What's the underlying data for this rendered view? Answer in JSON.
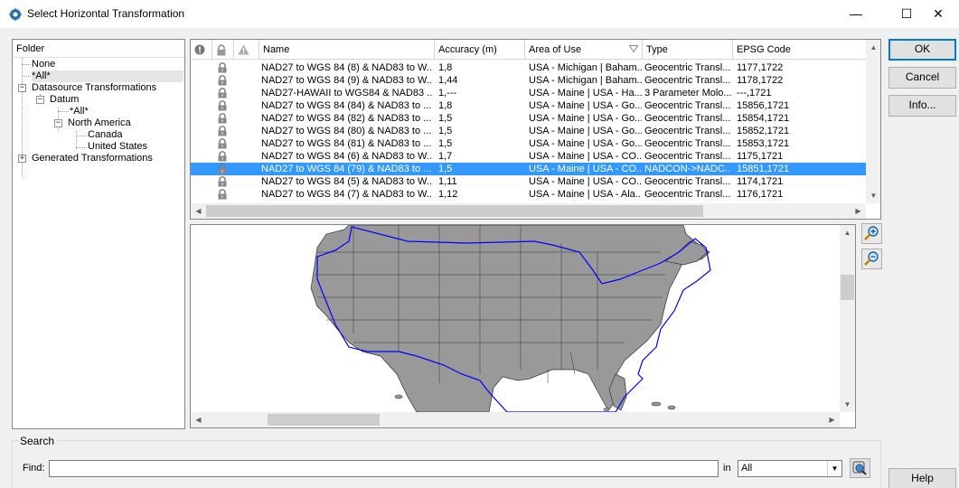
{
  "window": {
    "title": "Select Horizontal Transformation",
    "minimize_glyph": "—",
    "maximize_glyph": "☐",
    "close_glyph": "✕"
  },
  "folder": {
    "header": "Folder",
    "tree": [
      {
        "label": "None",
        "expander": ""
      },
      {
        "label": "*All*",
        "expander": "",
        "selected": true
      },
      {
        "label": "Datasource Transformations",
        "expander": "−"
      },
      {
        "label": "Datum",
        "expander": "−"
      },
      {
        "label": "*All*",
        "expander": ""
      },
      {
        "label": "North America",
        "expander": "−"
      },
      {
        "label": "Canada",
        "expander": ""
      },
      {
        "label": "United States",
        "expander": ""
      },
      {
        "label": "Generated Transformations",
        "expander": "+"
      }
    ]
  },
  "grid": {
    "columns": [
      "",
      "",
      "",
      "Name",
      "Accuracy (m)",
      "Area of Use",
      "Type",
      "EPSG Code"
    ],
    "header_icons": [
      "warning-circle-icon",
      "lock-icon",
      "alert-triangle-icon"
    ],
    "rows": [
      {
        "name": "NAD27 to WGS 84 (8) & NAD83 to W...",
        "accuracy": "1,8",
        "area": "USA - Michigan | Baham...",
        "type": "Geocentric Transl...",
        "epsg": "1177,1722"
      },
      {
        "name": "NAD27 to WGS 84 (9) & NAD83 to W...",
        "accuracy": "1,44",
        "area": "USA - Michigan | Baham...",
        "type": "Geocentric Transl...",
        "epsg": "1178,1722"
      },
      {
        "name": "NAD27-HAWAII to WGS84 & NAD83 ...",
        "accuracy": "1,---",
        "area": "USA - Maine | USA - Ha...",
        "type": "3 Parameter Molo...",
        "epsg": "---,1721"
      },
      {
        "name": "NAD27 to WGS 84 (84) & NAD83 to ...",
        "accuracy": "1,8",
        "area": "USA - Maine | USA - Go...",
        "type": "Geocentric Transl...",
        "epsg": "15856,1721"
      },
      {
        "name": "NAD27 to WGS 84 (82) & NAD83 to ...",
        "accuracy": "1,5",
        "area": "USA - Maine | USA - Go...",
        "type": "Geocentric Transl...",
        "epsg": "15854,1721"
      },
      {
        "name": "NAD27 to WGS 84 (80) & NAD83 to ...",
        "accuracy": "1,5",
        "area": "USA - Maine | USA - Go...",
        "type": "Geocentric Transl...",
        "epsg": "15852,1721"
      },
      {
        "name": "NAD27 to WGS 84 (81) & NAD83 to ...",
        "accuracy": "1,5",
        "area": "USA - Maine | USA - Go...",
        "type": "Geocentric Transl...",
        "epsg": "15853,1721"
      },
      {
        "name": "NAD27 to WGS 84 (6) & NAD83 to W...",
        "accuracy": "1,7",
        "area": "USA - Maine | USA - CO...",
        "type": "Geocentric Transl...",
        "epsg": "1175,1721"
      },
      {
        "name": "NAD27 to WGS 84 (79) & NAD83 to ...",
        "accuracy": "1,5",
        "area": "USA - Maine | USA - CO...",
        "type": "NADCON->NADC...",
        "epsg": "15851,1721",
        "selected": true
      },
      {
        "name": "NAD27 to WGS 84 (5) & NAD83 to W...",
        "accuracy": "1,11",
        "area": "USA - Maine | USA - CO...",
        "type": "Geocentric Transl...",
        "epsg": "1174,1721"
      },
      {
        "name": "NAD27 to WGS 84 (7) & NAD83 to W...",
        "accuracy": "1,12",
        "area": "USA - Maine | USA - Ala...",
        "type": "Geocentric Transl...",
        "epsg": "1176,1721"
      }
    ]
  },
  "buttons": {
    "ok": "OK",
    "cancel": "Cancel",
    "info": "Info...",
    "help": "Help"
  },
  "search": {
    "legend": "Search",
    "find_label": "Find:",
    "find_value": "",
    "in_label": "in",
    "in_value": "All"
  },
  "colors": {
    "selection": "#3399ff",
    "land": "#999999",
    "extent_line": "#0000ff"
  }
}
